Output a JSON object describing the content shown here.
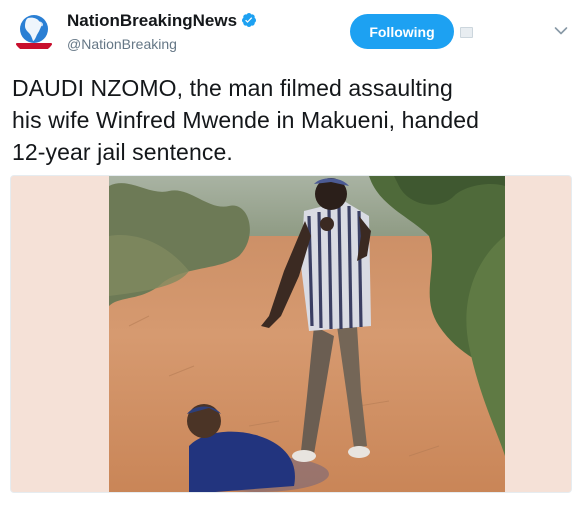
{
  "author": {
    "name": "NationBreakingNews",
    "handle": "@NationBreaking",
    "avatar_label": "BREAKING NEWS",
    "verified": true
  },
  "follow_button": {
    "label": "Following"
  },
  "tweet": {
    "lines": [
      "DAUDI NZOMO, the man filmed assaulting",
      "his wife Winfred Mwende in Makueni, handed",
      "12-year jail sentence."
    ]
  },
  "colors": {
    "brand_blue": "#1da1f2",
    "text_primary": "#14171a",
    "text_secondary": "#657786",
    "media_pillarbox": "#f5e1d7"
  },
  "icons": {
    "verified": "verified-badge-icon",
    "card": "card-icon",
    "menu": "chevron-down-icon"
  }
}
